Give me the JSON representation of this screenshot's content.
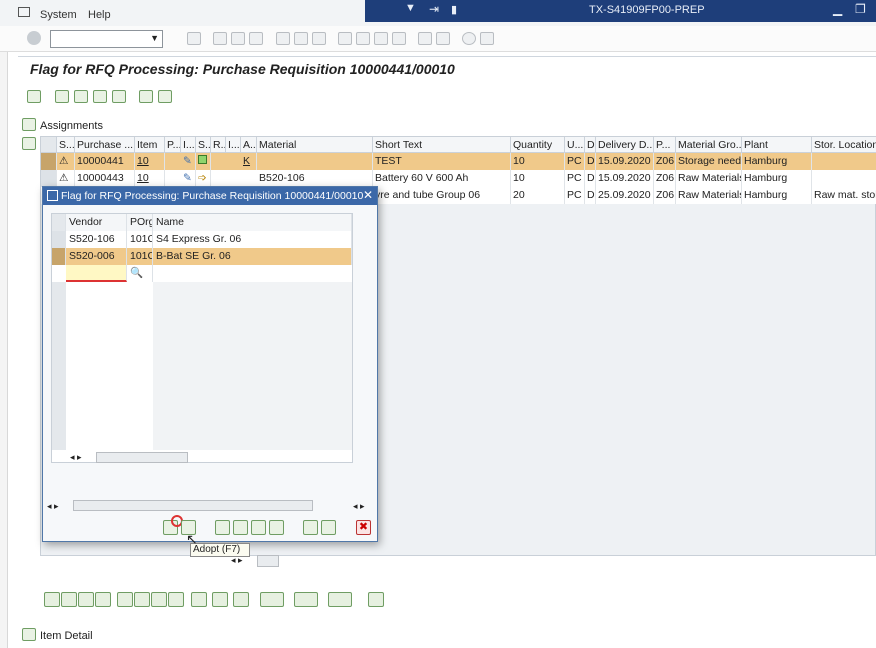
{
  "menubar": {
    "system": "System",
    "help": "Help"
  },
  "titlebar": {
    "system_id": "TX-S41909FP00-PREP"
  },
  "page": {
    "title": "Flag for RFQ Processing: Purchase Requisition 10000441/00010"
  },
  "assignments": {
    "label": "Assignments",
    "columns": [
      "S...",
      "Purchase ...",
      "Item",
      "P...",
      "I...",
      "S...",
      "R...",
      "I...",
      "A...",
      "Material",
      "Short Text",
      "Quantity",
      "U...",
      "D",
      "Delivery D...",
      "P...",
      "Material Gro...",
      "Plant",
      "Stor. Location"
    ],
    "rows": [
      {
        "purchase_req": "10000441",
        "item": "10",
        "acct": "K",
        "material": "",
        "short_text": "TEST",
        "quantity": "10",
        "unit": "PC",
        "d": "D",
        "delivery_date": "15.09.2020",
        "p": "Z06",
        "material_group": "Storage need...",
        "plant": "Hamburg",
        "stor_loc": ""
      },
      {
        "purchase_req": "10000443",
        "item": "10",
        "acct": "",
        "material": "B520-106",
        "short_text": "Battery 60 V 600 Ah",
        "quantity": "10",
        "unit": "PC",
        "d": "D",
        "delivery_date": "15.09.2020",
        "p": "Z06",
        "material_group": "Raw Materials",
        "plant": "Hamburg",
        "stor_loc": ""
      },
      {
        "purchase_req": "",
        "item": "",
        "acct": "",
        "material": "",
        "short_text": "yre and tube Group 06",
        "quantity": "20",
        "unit": "PC",
        "d": "D",
        "delivery_date": "25.09.2020",
        "p": "Z06",
        "material_group": "Raw Materials",
        "plant": "Hamburg",
        "stor_loc": "Raw mat. stol..."
      }
    ]
  },
  "popup": {
    "title": "Flag for RFQ Processing: Purchase Requisition 10000441/00010",
    "columns": {
      "vendor": "Vendor",
      "porg": "POrg",
      "name": "Name"
    },
    "rows": [
      {
        "vendor": "S520-106",
        "porg": "101C",
        "name": "S4 Express Gr. 06"
      },
      {
        "vendor": "S520-006",
        "porg": "101C",
        "name": "B-Bat SE Gr. 06"
      }
    ],
    "tooltip": "Adopt  (F7)"
  },
  "footer": {
    "item_detail": "Item Detail"
  },
  "colors": {
    "title_strip": "#1e3e7a",
    "selected_row": "#f0c98a",
    "popup_header": "#3b68a8"
  }
}
